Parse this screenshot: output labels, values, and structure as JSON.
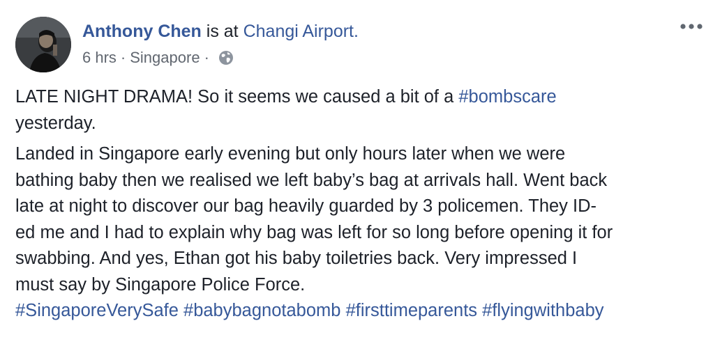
{
  "post": {
    "author_name": "Anthony Chen",
    "checkin_connector": " is at ",
    "location": "Changi Airport.",
    "timestamp": "6 hrs",
    "separator": "·",
    "city": "Singapore",
    "privacy_icon": "globe-icon",
    "more_icon": "more-options-icon",
    "avatar_icon": "profile-photo"
  },
  "body": {
    "para1_text": "LATE NIGHT DRAMA! So it seems we caused a bit of a ",
    "para1_hashtag": "#bombscare",
    "para1_line2": "yesterday.",
    "para2_lines": [
      "Landed in Singapore early evening but only hours later when we were",
      "bathing baby then we realised we left baby’s bag at arrivals hall. Went back",
      "late at night to discover our bag heavily guarded by 3 policemen. They ID-",
      "ed me and I had to explain why bag was left for so long before opening it for",
      "swabbing. And yes, Ethan got his baby toiletries back. Very impressed I",
      "must say by Singapore Police Force."
    ],
    "hashtags": [
      "#SingaporeVerySafe",
      "#babybagnotabomb",
      "#firsttimeparents",
      "#flyingwithbaby"
    ]
  },
  "colors": {
    "link": "#365899",
    "text": "#1d2129",
    "meta": "#616770"
  }
}
